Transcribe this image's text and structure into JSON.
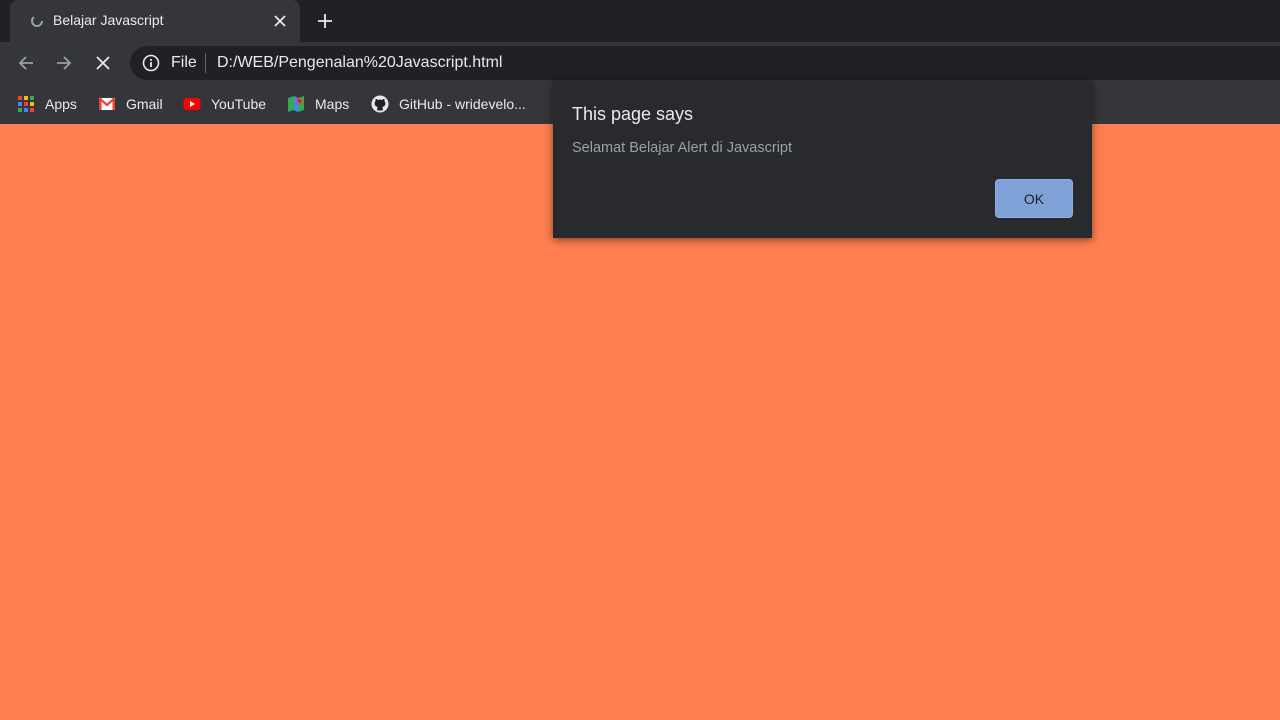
{
  "tab": {
    "title": "Belajar Javascript",
    "favicon": "loading-spinner-icon",
    "close_icon": "close-icon"
  },
  "newtab_icon": "plus-icon",
  "toolbar": {
    "back_icon": "back-arrow-icon",
    "forward_icon": "forward-arrow-icon",
    "stop_icon": "stop-icon"
  },
  "omnibox": {
    "info_icon": "info-icon",
    "scheme_label": "File",
    "url": "D:/WEB/Pengenalan%20Javascript.html"
  },
  "bookmarks": [
    {
      "label": "Apps",
      "icon": "apps-grid-icon"
    },
    {
      "label": "Gmail",
      "icon": "gmail-icon"
    },
    {
      "label": "YouTube",
      "icon": "youtube-icon"
    },
    {
      "label": "Maps",
      "icon": "maps-icon"
    },
    {
      "label": "GitHub - wridevelo...",
      "icon": "github-icon"
    }
  ],
  "page": {
    "background_color": "#ff7f50"
  },
  "dialog": {
    "title": "This page says",
    "message": "Selamat Belajar Alert di Javascript",
    "ok_label": "OK"
  }
}
